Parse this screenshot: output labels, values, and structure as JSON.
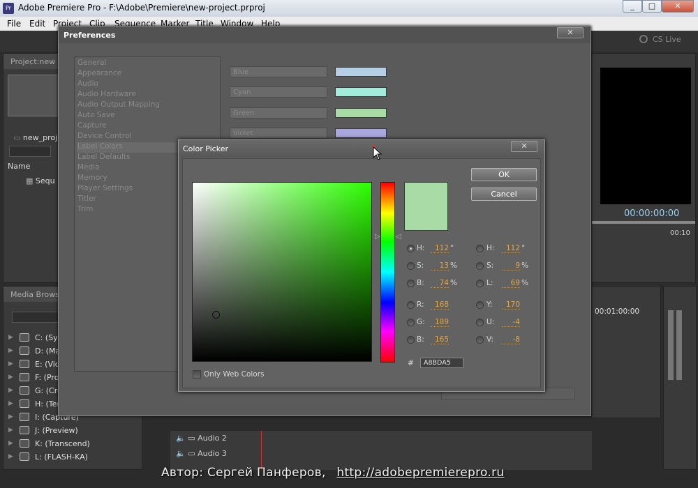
{
  "window": {
    "title": "Adobe Premiere Pro - F:\\Adobe\\Premiere\\new-project.prproj",
    "app_icon": "Pr",
    "minimize": "_",
    "maximize": "□",
    "close": "✕"
  },
  "menu": [
    "File",
    "Edit",
    "Project",
    "Clip",
    "Sequence",
    "Marker",
    "Title",
    "Window",
    "Help"
  ],
  "workspace": {
    "cs_live": "CS Live"
  },
  "project_panel": {
    "tab": "Project:new",
    "item": "new_proj",
    "column_name": "Name",
    "sequence": "Sequ"
  },
  "media_browser": {
    "tab": "Media Browser",
    "drives": [
      "C: (Sys",
      "D: (Ma",
      "E: (Vid",
      "F: (Pro",
      "G: (Cre",
      "H: (Ter",
      "I: (Capture)",
      "J: (Preview)",
      "K: (Transcend)",
      "L: (FLASH-KA)"
    ]
  },
  "monitor": {
    "timecode": "00:00:00:00",
    "timecode2": "00:10",
    "timeline_tc": "00:01:00:00"
  },
  "timeline": {
    "tracks": [
      "Audio 2",
      "Audio 3"
    ]
  },
  "preferences": {
    "title": "Preferences",
    "close": "✕",
    "categories": [
      "General",
      "Appearance",
      "Audio",
      "Audio Hardware",
      "Audio Output Mapping",
      "Auto Save",
      "Capture",
      "Device Control",
      "Label Colors",
      "Label Defaults",
      "Media",
      "Memory",
      "Player Settings",
      "Titler",
      "Trim"
    ],
    "selected_category": "Label Colors",
    "label_colors": [
      {
        "name": "Blue",
        "color": "#b4cfe6"
      },
      {
        "name": "Cyan",
        "color": "#a3ecdc"
      },
      {
        "name": "Green",
        "color": "#a8dba5"
      },
      {
        "name": "Violet",
        "color": "#a9a7de"
      }
    ]
  },
  "color_picker": {
    "title": "Color Picker",
    "close": "✕",
    "ok": "OK",
    "cancel": "Cancel",
    "new_color": "#a8dba5",
    "hsb": [
      {
        "label": "H:",
        "value": "112",
        "unit": "°",
        "selected": true
      },
      {
        "label": "S:",
        "value": "13",
        "unit": "%",
        "selected": false
      },
      {
        "label": "B:",
        "value": "74",
        "unit": "%",
        "selected": false
      }
    ],
    "rgb": [
      {
        "label": "R:",
        "value": "168"
      },
      {
        "label": "G:",
        "value": "189"
      },
      {
        "label": "B:",
        "value": "165"
      }
    ],
    "hsl": [
      {
        "label": "H:",
        "value": "112",
        "unit": "°"
      },
      {
        "label": "S:",
        "value": "9",
        "unit": "%"
      },
      {
        "label": "L:",
        "value": "69",
        "unit": "%"
      }
    ],
    "yuv": [
      {
        "label": "Y:",
        "value": "170"
      },
      {
        "label": "U:",
        "value": "-4"
      },
      {
        "label": "V:",
        "value": "-8"
      }
    ],
    "hex_symbol": "#",
    "hex": "A8BDA5",
    "only_web_colors": "Only Web Colors"
  },
  "credit": {
    "author": "Автор: Сергей Панферов,",
    "url": "http://adobepremierepro.ru"
  }
}
